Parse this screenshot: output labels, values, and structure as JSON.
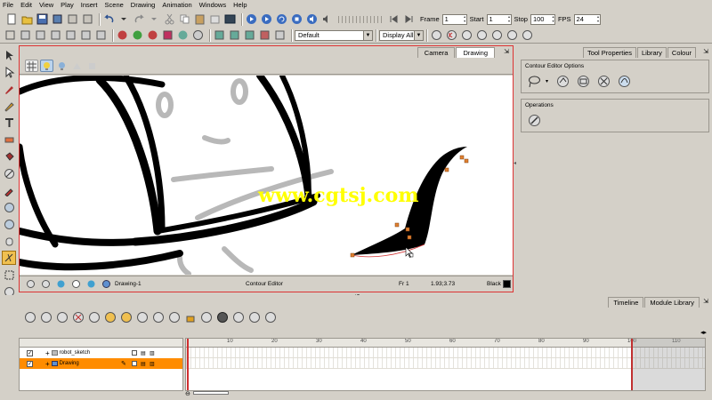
{
  "menu": [
    "File",
    "Edit",
    "View",
    "Play",
    "Insert",
    "Scene",
    "Drawing",
    "Animation",
    "Windows",
    "Help"
  ],
  "playback": {
    "frame_label": "Frame",
    "frame_value": "1",
    "start_label": "Start",
    "start_value": "1",
    "stop_label": "Stop",
    "stop_value": "100",
    "fps_label": "FPS",
    "fps_value": "24"
  },
  "toolbar2": {
    "palette_combo": "Default",
    "display_combo": "Display All"
  },
  "view": {
    "tabs": [
      "Camera",
      "Drawing"
    ],
    "active_tab": "Drawing",
    "status": {
      "drawing_name": "Drawing-1",
      "tool_name": "Contour Editor",
      "frame": "Fr 1",
      "coords": "1.93;3.73",
      "color_name": "Black",
      "color_hex": "#000000"
    },
    "watermark": "www.cgtsj.com",
    "watermark_color": "#ffff00"
  },
  "right_panel": {
    "tabs": [
      "Tool Properties",
      "Library",
      "Colour"
    ],
    "active_tab": "Tool Properties",
    "group1_title": "Contour Editor Options",
    "group2_title": "Operations"
  },
  "timeline": {
    "tabs": [
      "Timeline",
      "Module Library"
    ],
    "active_tab": "Timeline",
    "layers": [
      {
        "name": "robot_sketch",
        "checked": "✓",
        "selected": false
      },
      {
        "name": "Drawing",
        "checked": "✓",
        "selected": true
      }
    ],
    "ruler_ticks": [
      "10",
      "20",
      "30",
      "40",
      "50",
      "60",
      "70",
      "80",
      "90",
      "100",
      "110"
    ],
    "stop_frame": 100,
    "accent_color": "#ff8c00"
  }
}
